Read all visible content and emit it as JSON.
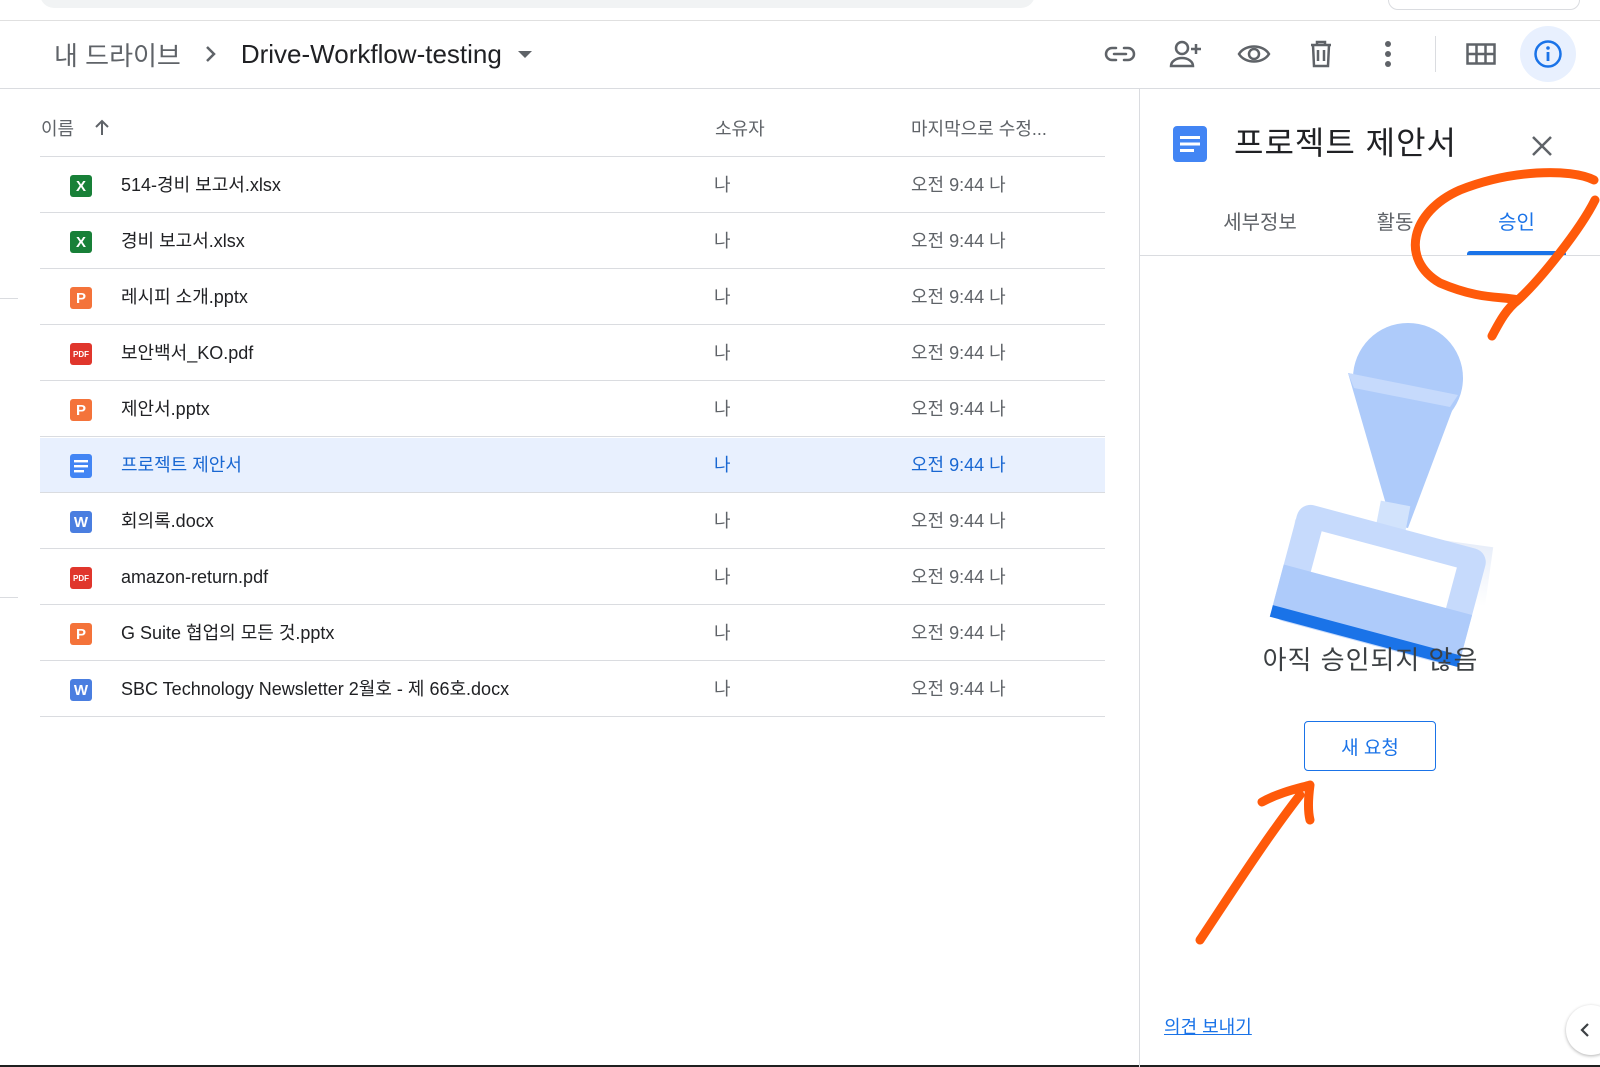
{
  "breadcrumb": {
    "root": "내 드라이브",
    "current": "Drive-Workflow-testing"
  },
  "toolbar": {
    "icons": [
      "link-icon",
      "add-person-icon",
      "eye-icon",
      "trash-icon",
      "more-vert-icon",
      "grid-view-icon",
      "info-icon"
    ]
  },
  "list": {
    "columns": {
      "name": "이름",
      "owner": "소유자",
      "modified": "마지막으로 수정..."
    },
    "rows": [
      {
        "name": "514-경비 보고서.xlsx",
        "type": "xlsx",
        "owner": "나",
        "modified": "오전 9:44 나"
      },
      {
        "name": "경비 보고서.xlsx",
        "type": "xlsx",
        "owner": "나",
        "modified": "오전 9:44 나"
      },
      {
        "name": "레시피 소개.pptx",
        "type": "pptx",
        "owner": "나",
        "modified": "오전 9:44 나"
      },
      {
        "name": "보안백서_KO.pdf",
        "type": "pdf",
        "owner": "나",
        "modified": "오전 9:44 나"
      },
      {
        "name": "제안서.pptx",
        "type": "pptx",
        "owner": "나",
        "modified": "오전 9:44 나"
      },
      {
        "name": "프로젝트 제안서",
        "type": "gdoc",
        "owner": "나",
        "modified": "오전 9:44 나",
        "selected": true
      },
      {
        "name": "회의록.docx",
        "type": "docx",
        "owner": "나",
        "modified": "오전 9:44 나"
      },
      {
        "name": "amazon-return.pdf",
        "type": "pdf",
        "owner": "나",
        "modified": "오전 9:44 나"
      },
      {
        "name": "G Suite 협업의 모든 것.pptx",
        "type": "pptx",
        "owner": "나",
        "modified": "오전 9:44 나"
      },
      {
        "name": "SBC Technology Newsletter 2월호 - 제 66호.docx",
        "type": "docx",
        "owner": "나",
        "modified": "오전 9:44 나"
      }
    ]
  },
  "file_icon_labels": {
    "xlsx": "X",
    "pptx": "P",
    "pdf": "PDF",
    "docx": "W"
  },
  "colors": {
    "xlsx": "#188038",
    "pptx": "#f4733a",
    "pdf": "#e0362c",
    "docx": "#4a7ee0",
    "gdoc": "#4285f4",
    "accent": "#1a73e8",
    "annotation": "#ff5a0a"
  },
  "panel": {
    "title": "프로젝트 제안서",
    "tabs": [
      "세부정보",
      "활동",
      "승인"
    ],
    "active_tab": 2,
    "empty_text": "아직 승인되지 않음",
    "new_request_label": "새 요청",
    "feedback_label": "의견 보내기"
  }
}
